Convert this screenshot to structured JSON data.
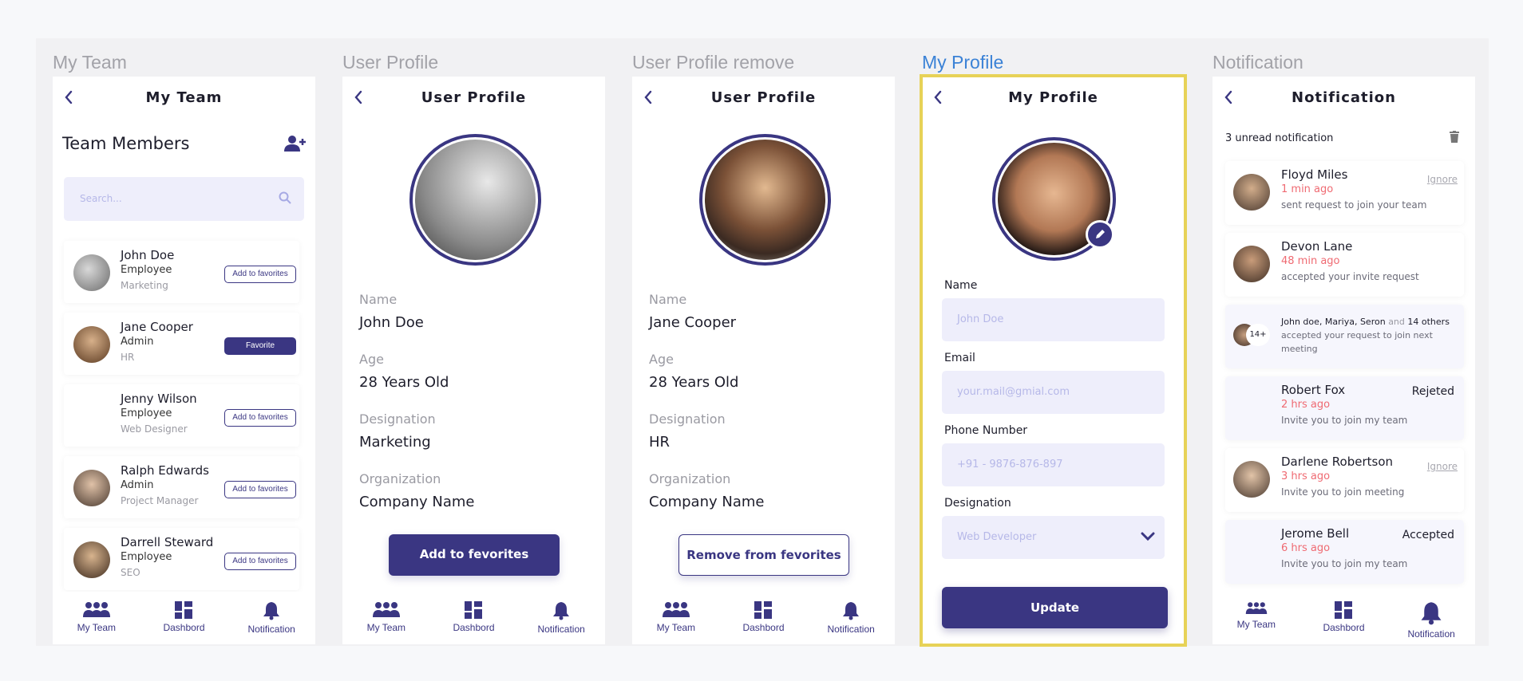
{
  "frames": {
    "my_team": "My Team",
    "user_profile": "User Profile",
    "user_profile_remove": "User Profile remove",
    "my_profile": "My Profile",
    "notification": "Notification"
  },
  "nav": {
    "team": "My Team",
    "dashboard": "Dashbord",
    "notification": "Notification"
  },
  "team_screen": {
    "title": "My Team",
    "heading": "Team Members",
    "search_placeholder": "Search...",
    "members": [
      {
        "name": "John Doe",
        "role": "Employee",
        "dept": "Marketing",
        "button": "Add to favorites"
      },
      {
        "name": "Jane Cooper",
        "role": "Admin",
        "dept": "HR",
        "button": "Favorite"
      },
      {
        "name": "Jenny Wilson",
        "role": "Employee",
        "dept": "Web Designer",
        "button": "Add to favorites"
      },
      {
        "name": "Ralph Edwards",
        "role": "Admin",
        "dept": "Project Manager",
        "button": "Add to favorites"
      },
      {
        "name": "Darrell Steward",
        "role": "Employee",
        "dept": "SEO",
        "button": "Add to favorites"
      }
    ]
  },
  "profile_screen": {
    "title": "User Profile",
    "fields": [
      {
        "label": "Name",
        "value": "John Doe"
      },
      {
        "label": "Age",
        "value": "28 Years Old"
      },
      {
        "label": "Designation",
        "value": "Marketing"
      },
      {
        "label": "Organization",
        "value": "Company Name"
      }
    ],
    "button": "Add to fevorites"
  },
  "profile_remove_screen": {
    "title": "User Profile",
    "fields": [
      {
        "label": "Name",
        "value": "Jane Cooper"
      },
      {
        "label": "Age",
        "value": "28 Years Old"
      },
      {
        "label": "Designation",
        "value": "HR"
      },
      {
        "label": "Organization",
        "value": "Company Name"
      }
    ],
    "button": "Remove from fevorites"
  },
  "my_profile_screen": {
    "title": "My Profile",
    "name_label": "Name",
    "name_placeholder": "John Doe",
    "email_label": "Email",
    "email_placeholder": "your.mail@gmial.com",
    "phone_label": "Phone Number",
    "phone_placeholder": "+91 - 9876-876-897",
    "designation_label": "Designation",
    "designation_value": "Web Developer",
    "button": "Update"
  },
  "notif_screen": {
    "title": "Notification",
    "unread": "3 unread notification",
    "items": [
      {
        "name": "Floyd Miles",
        "time": "1 min ago",
        "desc": "sent request to join your team",
        "action": "Ignore"
      },
      {
        "name": "Devon Lane",
        "time": "48 min ago",
        "desc": "accepted your invite request",
        "action": ""
      },
      {
        "name": "",
        "time": "",
        "desc": "",
        "action": ""
      },
      {
        "name": "Robert Fox",
        "time": "2 hrs ago",
        "desc": "Invite you to join my team",
        "action": "Rejeted"
      },
      {
        "name": "Darlene Robertson",
        "time": "3 hrs ago",
        "desc": "Invite you to join meeting",
        "action": "Ignore"
      },
      {
        "name": "Jerome Bell",
        "time": "6 hrs ago",
        "desc": "Invite you to join my team",
        "action": "Accepted"
      }
    ],
    "group": {
      "names": "John doe, Mariya, Seron",
      "and": "and",
      "others": "14 others",
      "desc": "accepted your request to join next meeting",
      "badge": "14+"
    }
  },
  "colors": {
    "accent": "#3a3682",
    "input_bg": "#eeeefb",
    "time_red": "#ef6a72",
    "selection": "#e7d257",
    "frame_title_active": "#3b82d6"
  }
}
